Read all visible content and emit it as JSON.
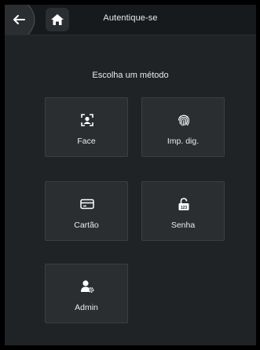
{
  "header": {
    "title": "Autentique-se",
    "back_icon": "arrow-left-icon",
    "home_icon": "home-icon"
  },
  "main": {
    "subtitle": "Escolha um método",
    "methods": [
      {
        "label": "Face",
        "icon": "face-scan-icon"
      },
      {
        "label": "Imp. dig.",
        "icon": "fingerprint-icon"
      },
      {
        "label": "Cartão",
        "icon": "card-icon"
      },
      {
        "label": "Senha",
        "icon": "password-lock-icon"
      },
      {
        "label": "Admin",
        "icon": "admin-user-gear-icon"
      }
    ]
  },
  "colors": {
    "background": "#202326",
    "topbar": "#171a1c",
    "tile": "#2a2e31",
    "text": "#e9ecef"
  }
}
